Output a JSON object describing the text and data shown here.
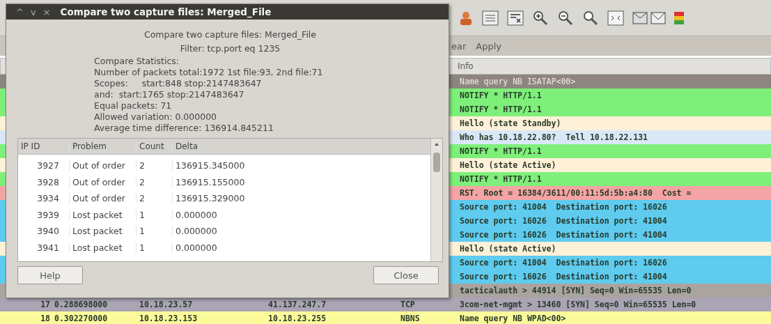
{
  "main_window": {
    "filter_bar": {
      "clear_button": "ear",
      "apply_button": "Apply"
    },
    "packet_list": {
      "columns": [
        "Info"
      ],
      "rows": [
        {
          "info": "Name query NB ISATAP<00>",
          "selected": true
        },
        {
          "info": "NOTIFY * HTTP/1.1",
          "selected": false,
          "color": "#7ef07a"
        },
        {
          "info": "NOTIFY * HTTP/1.1",
          "selected": false,
          "color": "#7ef07a"
        },
        {
          "info": "Hello (state Standby)",
          "selected": false,
          "color": "#fff1d8"
        },
        {
          "info": "Who has 10.18.22.80?  Tell 10.18.22.131",
          "selected": false,
          "color": "#d9e8f6"
        },
        {
          "info": "NOTIFY * HTTP/1.1",
          "selected": false,
          "color": "#7ef07a"
        },
        {
          "info": "Hello (state Active)",
          "selected": false,
          "color": "#fff1d8"
        },
        {
          "info": "NOTIFY * HTTP/1.1",
          "selected": false,
          "color": "#7ef07a"
        },
        {
          "info": "RST. Root = 16384/3611/00:11:5d:5b:a4:80  Cost =",
          "selected": false,
          "color": "#f4a4a4"
        },
        {
          "info": "Source port: 41004  Destination port: 16026",
          "selected": false,
          "color": "#5ecbef"
        },
        {
          "info": "Source port: 16026  Destination port: 41004",
          "selected": false,
          "color": "#5ecbef"
        },
        {
          "info": "Source port: 16026  Destination port: 41004",
          "selected": false,
          "color": "#5ecbef"
        },
        {
          "info": "Hello (state Active)",
          "selected": false,
          "color": "#fff1d8"
        },
        {
          "info": "Source port: 41004  Destination port: 16026",
          "selected": false,
          "color": "#5ecbef"
        },
        {
          "info": "Source port: 16026  Destination port: 41004",
          "selected": false,
          "color": "#5ecbef"
        },
        {
          "info": "tacticalauth > 44914 [SYN] Seq=0 Win=65535 Len=0",
          "selected": false,
          "color": "#a9a4a0"
        },
        {
          "no": "17",
          "time": "0.288698000",
          "source": "10.18.23.57",
          "destination": "41.137.247.7",
          "protocol": "TCP",
          "info": "3com-net-mgmt > 13460 [SYN] Seq=0 Win=65535 Len=0",
          "selected": false,
          "color": "#aaa4b4"
        },
        {
          "no": "18",
          "time": "0.302270000",
          "source": "10.18.23.153",
          "destination": "10.18.23.255",
          "protocol": "NBNS",
          "info": "Name query NB WPAD<00>",
          "selected": false,
          "color": "#fbfb9c"
        }
      ]
    }
  },
  "dialog": {
    "title_buttons": [
      "^",
      "v",
      "×"
    ],
    "title": "Compare two capture files: Merged_File",
    "heading": "Compare two capture files: Merged_File",
    "filter": "Filter: tcp.port eq 1235",
    "statistics": [
      "Compare Statistics:",
      "Number of packets total:1972 1st file:93, 2nd file:71",
      "Scopes:     start:848 stop:2147483647",
      "and:  start:1765 stop:2147483647",
      "Equal packets: 71",
      "Allowed variation: 0.000000",
      "Average time difference: 136914.845211"
    ],
    "table": {
      "columns": [
        "IP ID",
        "Problem",
        "Count",
        "Delta"
      ],
      "rows": [
        {
          "ip_id": "3927",
          "problem": "Out of order",
          "count": "2",
          "delta": "136915.345000"
        },
        {
          "ip_id": "3928",
          "problem": "Out of order",
          "count": "2",
          "delta": "136915.155000"
        },
        {
          "ip_id": "3934",
          "problem": "Out of order",
          "count": "2",
          "delta": "136915.329000"
        },
        {
          "ip_id": "3939",
          "problem": "Lost packet",
          "count": "1",
          "delta": "0.000000"
        },
        {
          "ip_id": "3940",
          "problem": "Lost packet",
          "count": "1",
          "delta": "0.000000"
        },
        {
          "ip_id": "3941",
          "problem": "Lost packet",
          "count": "1",
          "delta": "0.000000"
        }
      ]
    },
    "buttons": [
      "Help",
      "Close"
    ]
  }
}
